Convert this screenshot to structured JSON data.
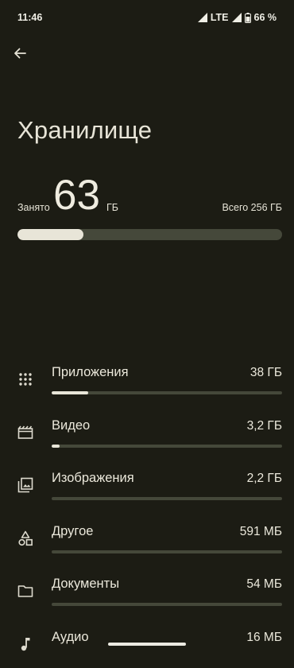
{
  "status_bar": {
    "time": "11:46",
    "network": "LTE",
    "battery": "66 %"
  },
  "header": {
    "title": "Хранилище"
  },
  "summary": {
    "used_label": "Занято",
    "used_value": "63",
    "used_unit": "ГБ",
    "total_label": "Всего 256 ГБ",
    "used_fraction": 0.25
  },
  "categories": [
    {
      "icon": "apps-grid-icon",
      "name": "Приложения",
      "size": "38 ГБ",
      "fraction": 0.16
    },
    {
      "icon": "video-icon",
      "name": "Видео",
      "size": "3,2 ГБ",
      "fraction": 0.035
    },
    {
      "icon": "images-icon",
      "name": "Изображения",
      "size": "2,2 ГБ",
      "fraction": 0.0
    },
    {
      "icon": "shapes-icon",
      "name": "Другое",
      "size": "591 МБ",
      "fraction": 0.0
    },
    {
      "icon": "folder-icon",
      "name": "Документы",
      "size": "54 МБ",
      "fraction": 0.0
    },
    {
      "icon": "music-note-icon",
      "name": "Аудио",
      "size": "16 МБ",
      "fraction": 0.0
    }
  ]
}
